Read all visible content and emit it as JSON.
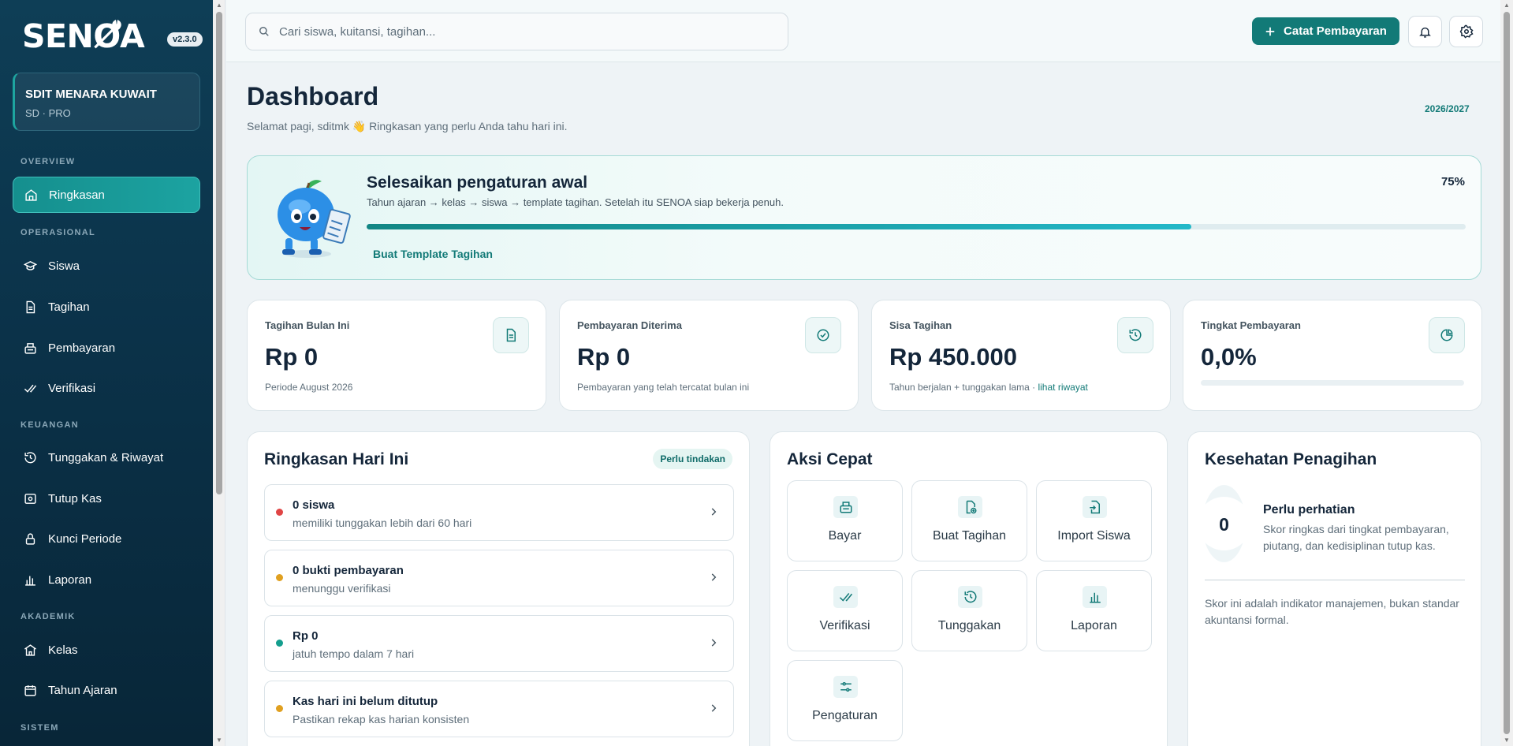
{
  "brand": {
    "name": "SENØA",
    "version": "v2.3.0"
  },
  "school": {
    "name": "SDIT MENARA KUWAIT",
    "plan": "SD · PRO"
  },
  "sidebar": {
    "sections": [
      "OVERVIEW",
      "OPERASIONAL",
      "KEUANGAN",
      "AKADEMIK",
      "SISTEM"
    ],
    "items": [
      {
        "label": "Ringkasan",
        "icon": "home-icon"
      },
      {
        "label": "Siswa",
        "icon": "graduation-cap-icon"
      },
      {
        "label": "Tagihan",
        "icon": "document-icon"
      },
      {
        "label": "Pembayaran",
        "icon": "register-icon"
      },
      {
        "label": "Verifikasi",
        "icon": "double-check-icon"
      },
      {
        "label": "Tunggakan & Riwayat",
        "icon": "history-icon"
      },
      {
        "label": "Tutup Kas",
        "icon": "cash-icon"
      },
      {
        "label": "Kunci Periode",
        "icon": "lock-icon"
      },
      {
        "label": "Laporan",
        "icon": "bar-chart-icon"
      },
      {
        "label": "Kelas",
        "icon": "school-icon"
      },
      {
        "label": "Tahun Ajaran",
        "icon": "calendar-icon"
      }
    ]
  },
  "topbar": {
    "search_placeholder": "Cari siswa, kuitansi, tagihan...",
    "cta_label": "Catat Pembayaran"
  },
  "header": {
    "title": "Dashboard",
    "subtitle": "Selamat pagi, sditmk 👋 Ringkasan yang perlu Anda tahu hari ini.",
    "year": "2026/2027"
  },
  "setup": {
    "title": "Selesaikan pengaturan awal",
    "description": "Tahun ajaran → kelas → siswa → template tagihan. Setelah itu SENOA siap bekerja penuh.",
    "progress_label": "75%",
    "progress": 0.75,
    "link": "Buat Template Tagihan"
  },
  "stats": [
    {
      "label": "Tagihan Bulan Ini",
      "value": "Rp 0",
      "footer": "Periode August 2026"
    },
    {
      "label": "Pembayaran Diterima",
      "value": "Rp 0",
      "footer": "Pembayaran yang telah tercatat bulan ini"
    },
    {
      "label": "Sisa Tagihan",
      "value": "Rp 450.000",
      "footer": "Tahun berjalan + tunggakan lama · ",
      "footer_link": "lihat riwayat"
    },
    {
      "label": "Tingkat Pembayaran",
      "value": "0,0%",
      "progress": 0.0
    }
  ],
  "today": {
    "title": "Ringkasan Hari Ini",
    "badge": "Perlu tindakan",
    "items": [
      {
        "title": "0 siswa",
        "subtitle": "memiliki tunggakan lebih dari 60 hari",
        "color": "#e04545"
      },
      {
        "title": "0 bukti pembayaran",
        "subtitle": "menunggu verifikasi",
        "color": "#e0a020"
      },
      {
        "title": "Rp 0",
        "subtitle": "jatuh tempo dalam 7 hari",
        "color": "#149e8e"
      },
      {
        "title": "Kas hari ini belum ditutup",
        "subtitle": "Pastikan rekap kas harian konsisten",
        "color": "#e0a020"
      }
    ]
  },
  "quick": {
    "title": "Aksi Cepat",
    "items": [
      "Bayar",
      "Buat Tagihan",
      "Import Siswa",
      "Verifikasi",
      "Tunggakan",
      "Laporan",
      "Pengaturan"
    ]
  },
  "health": {
    "title": "Kesehatan Penagihan",
    "score": "0",
    "status": "Perlu perhatian",
    "description": "Skor ringkas dari tingkat pembayaran, piutang, dan kedisiplinan tutup kas.",
    "note": "Skor ini adalah indikator manajemen, bukan standar akuntansi formal."
  }
}
